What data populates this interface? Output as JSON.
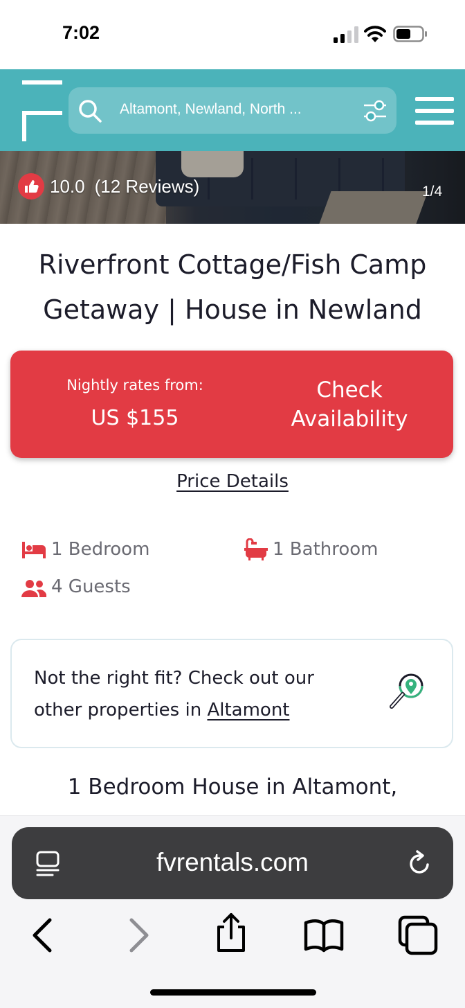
{
  "status_bar": {
    "time": "7:02"
  },
  "header": {
    "search_text": "Altamont, Newland, North ...",
    "brand_color": "#4bb3ba"
  },
  "hero": {
    "rating": "10.0",
    "reviews": "(12 Reviews)",
    "counter": "1/4"
  },
  "listing": {
    "title": "Riverfront Cottage/Fish Camp Getaway | House in Newland"
  },
  "booking": {
    "nightly_label": "Nightly rates from:",
    "price": "US $155",
    "check_label": "Check Availability",
    "accent_color": "#e23b44"
  },
  "price_details_label": "Price Details",
  "amenities": {
    "bedrooms": "1 Bedroom",
    "bathrooms": "1 Bathroom",
    "guests": "4 Guests"
  },
  "fit": {
    "line1": "Not the right fit? Check out our",
    "line2_prefix": "other properties in ",
    "link": "Altamont"
  },
  "subheading": "1 Bedroom House in Altamont,",
  "browser": {
    "url": "fvrentals.com"
  }
}
